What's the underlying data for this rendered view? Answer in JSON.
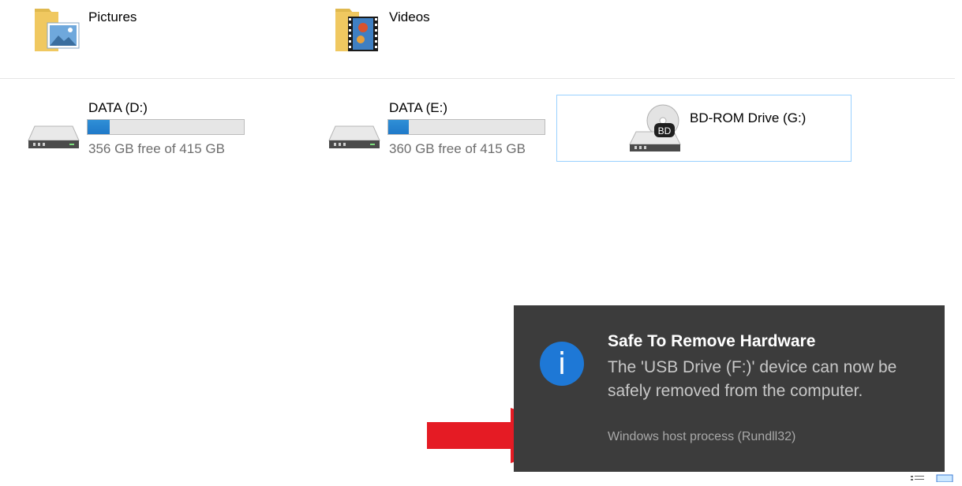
{
  "folders": [
    {
      "label": "Pictures",
      "icon": "pictures-folder-icon"
    },
    {
      "label": "Videos",
      "icon": "videos-folder-icon"
    }
  ],
  "drives": [
    {
      "label": "DATA (D:)",
      "free_text": "356 GB free of 415 GB",
      "used_fraction": 0.14,
      "icon": "hard-drive-icon"
    },
    {
      "label": "DATA (E:)",
      "free_text": "360 GB free of 415 GB",
      "used_fraction": 0.13,
      "icon": "hard-drive-icon"
    },
    {
      "label": "BD-ROM Drive (G:)",
      "icon": "bd-rom-drive-icon",
      "badge": "BD"
    }
  ],
  "notification": {
    "icon_glyph": "i",
    "title": "Safe To Remove Hardware",
    "body": "The 'USB Drive (F:)' device can now be safely removed from the computer.",
    "source": "Windows host process (Rundll32)"
  },
  "colors": {
    "toast_bg": "#3c3c3c",
    "info_blue": "#1e78d6",
    "bar_fill": "#2f8fd6",
    "arrow_red": "#e51b24",
    "selection_border": "#99d1ff"
  }
}
